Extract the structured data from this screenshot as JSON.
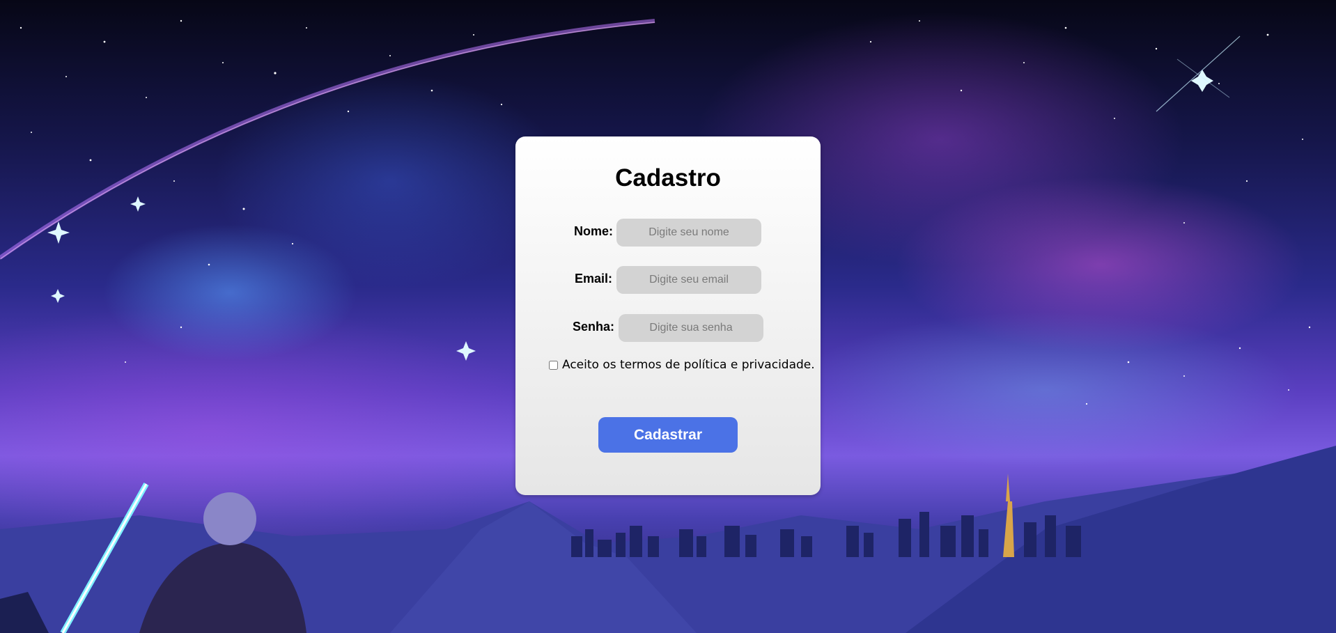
{
  "form": {
    "title": "Cadastro",
    "fields": [
      {
        "label": "Nome:",
        "placeholder": "Digite seu nome",
        "value": ""
      },
      {
        "label": "Email:",
        "placeholder": "Digite seu email",
        "value": ""
      },
      {
        "label": "Senha:",
        "placeholder": "Digite sua senha",
        "value": ""
      }
    ],
    "terms": {
      "label": "Aceito os termos de política e privacidade.",
      "checked": false
    },
    "submit_label": "Cadastrar"
  },
  "colors": {
    "card_background": "#f3f3f3",
    "input_background": "#d3d3d3",
    "button": "#4b72e6"
  }
}
